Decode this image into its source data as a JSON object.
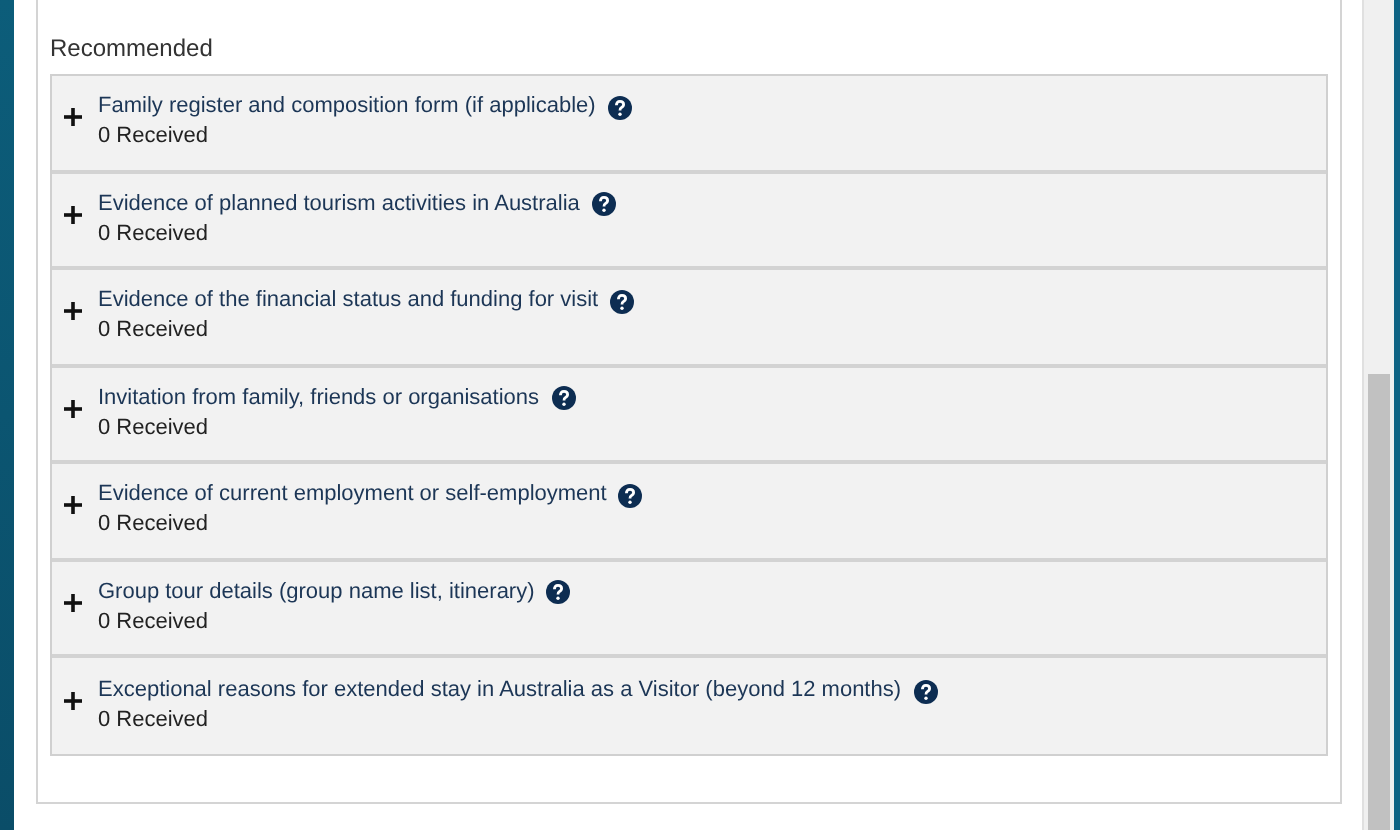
{
  "section": {
    "heading": "Recommended",
    "items": [
      {
        "title": "Family register and composition form (if applicable)",
        "status": "0 Received",
        "expanded": false
      },
      {
        "title": "Evidence of planned tourism activities in Australia",
        "status": "0 Received",
        "expanded": false
      },
      {
        "title": "Evidence of the financial status and funding for visit",
        "status": "0 Received",
        "expanded": false
      },
      {
        "title": "Invitation from family, friends or organisations",
        "status": "0 Received",
        "expanded": false
      },
      {
        "title": "Evidence of current employment or self-employment",
        "status": "0 Received",
        "expanded": false
      },
      {
        "title": "Group tour details (group name list, itinerary)",
        "status": "0 Received",
        "expanded": false
      },
      {
        "title": "Exceptional reasons for extended stay in Australia as a Visitor (beyond 12 months)",
        "status": "0 Received",
        "expanded": false
      }
    ]
  }
}
